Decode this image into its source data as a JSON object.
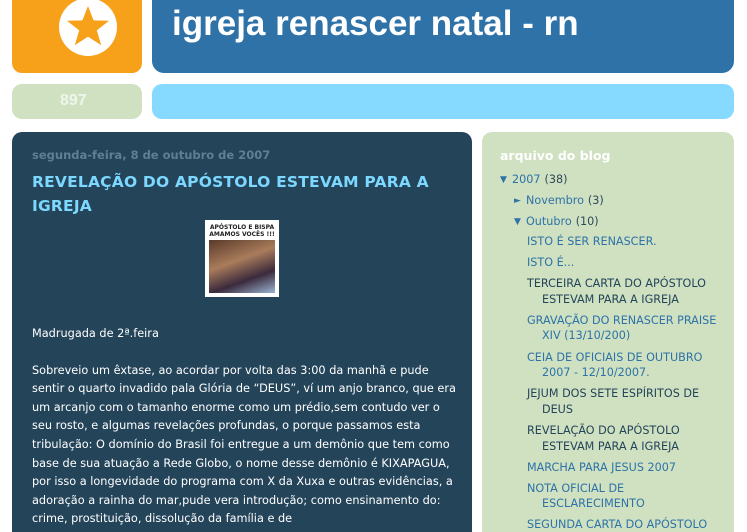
{
  "header": {
    "logo_icon": "star-icon",
    "title": "igreja renascer natal - rn",
    "counter": "897"
  },
  "post": {
    "date": "segunda-feira, 8 de outubro de 2007",
    "title": "REVELAÇÃO DO APÓSTOLO ESTEVAM PARA A IGREJA",
    "image_caption": "APÓSTOLO E BISPA AMAMOS VOCÊS !!!",
    "paragraphs": [
      "Madrugada de 2ª.feira",
      "Sobreveio um êxtase, ao acordar por volta das 3:00 da manhã e pude sentir o quarto invadido pala Glória de “DEUS”, ví um anjo branco, que era um arcanjo com o tamanho enorme como um prédio,sem contudo ver o seu rosto, e algumas revelações profundas, o porque passamos esta tribulação: O domínio do Brasil foi entregue a um demônio que tem como base de sua atuação a Rede Globo, o nome desse demônio é KIXAPAGUA, por isso a longevidade do programa com X da Xuxa e outras evidências, a adoração a rainha do mar,pude vera introdução; como ensinamento do: crime, prostituição, dissolução da família e de"
    ]
  },
  "sidebar": {
    "archive_title": "arquivo do blog",
    "years": [
      {
        "label": "2007",
        "count": "(38)",
        "toggle": "▼",
        "months": [
          {
            "label": "Novembro",
            "count": "(3)",
            "toggle": "►"
          },
          {
            "label": "Outubro",
            "count": "(10)",
            "toggle": "▼",
            "posts": [
              "ISTO É SER RENASCER.",
              "ISTO É...",
              "TERCEIRA CARTA DO APÓSTOLO ESTEVAM PARA A IGREJA",
              "GRAVAÇÃO DO RENASCER PRAISE XIV (13/10/200)",
              "CEIA DE OFICIAIS DE OUTUBRO 2007 - 12/10/2007.",
              "JEJUM DOS SETE ESPÍRITOS DE DEUS",
              "REVELAÇÃO DO APÓSTOLO ESTEVAM PARA A IGREJA",
              "MARCHA PARA JESUS 2007",
              "NOTA OFICIAL DE ESCLARECIMENTO",
              "SEGUNDA CARTA DO APÓSTOLO"
            ]
          }
        ]
      }
    ]
  },
  "colors": {
    "logo_bg": "#f7a11a",
    "title_bg": "#2e72a8",
    "desc_bg": "#87daff",
    "main_bg": "#24445a",
    "sidebar_bg": "#cfe1c1",
    "post_title": "#7cd8ff"
  }
}
